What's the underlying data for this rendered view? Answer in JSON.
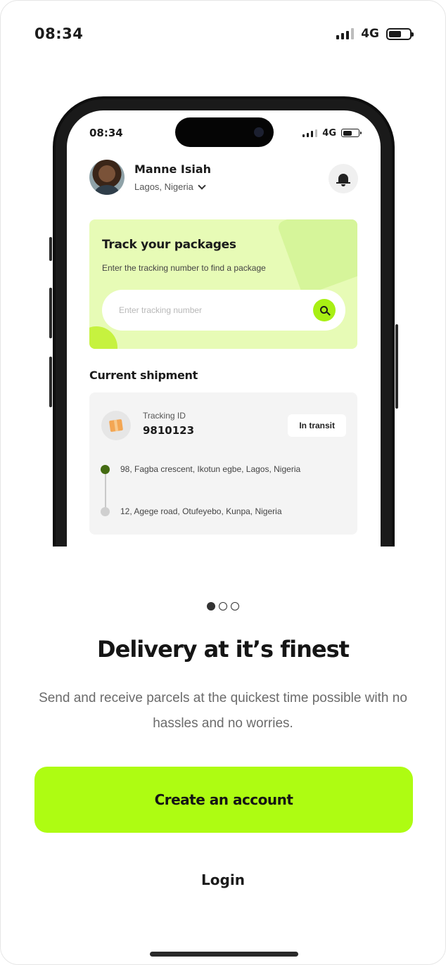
{
  "status_bar": {
    "time": "08:34",
    "network": "4G"
  },
  "mockup": {
    "status_bar": {
      "time": "08:34",
      "network": "4G"
    },
    "profile": {
      "name": "Manne Isiah",
      "location": "Lagos, Nigeria"
    },
    "track_card": {
      "title": "Track your packages",
      "subtitle": "Enter the tracking number to find a package",
      "input_placeholder": "Enter tracking number"
    },
    "current_shipment": {
      "title": "Current shipment",
      "tracking_id_label": "Tracking ID",
      "tracking_id": "9810123",
      "status": "In transit",
      "from_address": "98, Fagba crescent, Ikotun egbe, Lagos, Nigeria",
      "to_address": "12, Agege road, Otufeyebo, Kunpa, Nigeria"
    }
  },
  "onboarding": {
    "page_indicator": {
      "total": 3,
      "active": 1
    },
    "headline": "Delivery at it’s finest",
    "description": "Send and receive parcels at the quickest time possible with no hassles and no worries.",
    "primary_button": "Create an account",
    "secondary_button": "Login"
  },
  "colors": {
    "accent": "#aefc12",
    "track_card_bg": "#e7fbb6",
    "route_active": "#446b12"
  }
}
